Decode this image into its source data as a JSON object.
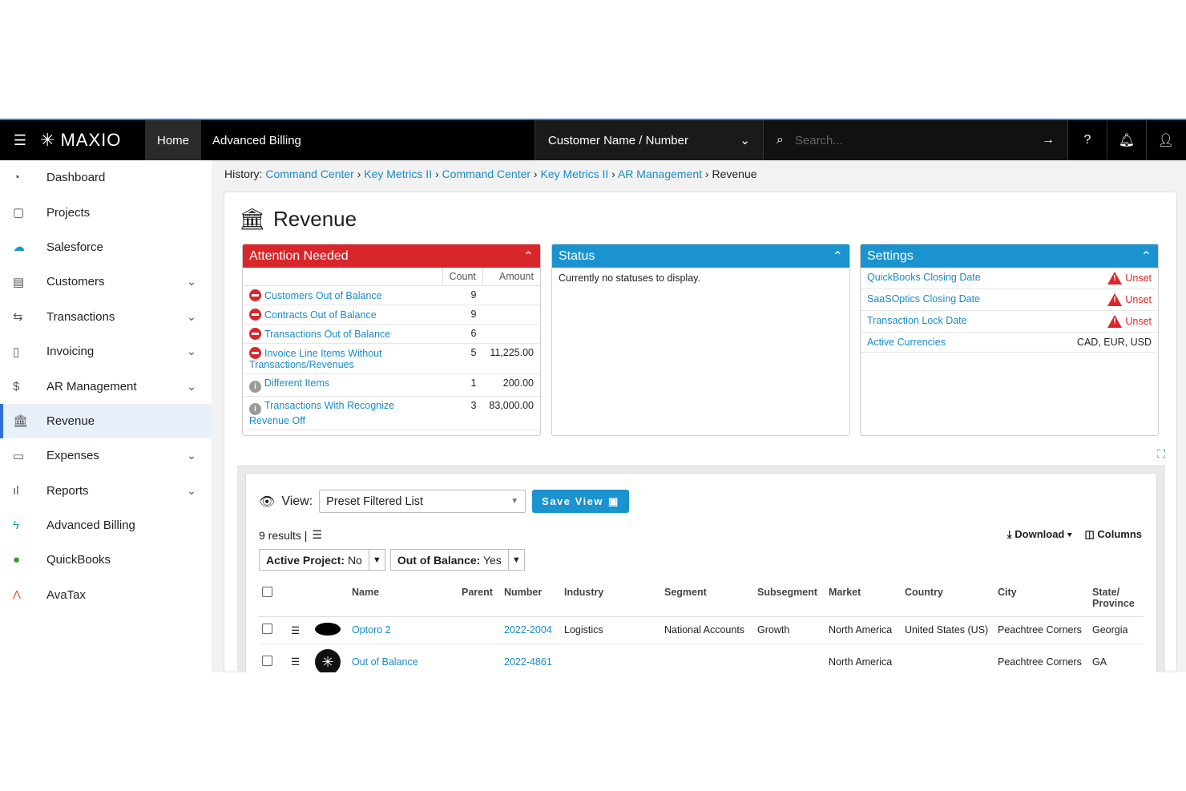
{
  "topbar": {
    "logo": "MAXIO",
    "home": "Home",
    "app": "Advanced Billing",
    "customer_select": "Customer Name / Number",
    "search_placeholder": "Search..."
  },
  "sidebar": {
    "items": [
      {
        "label": "Dashboard"
      },
      {
        "label": "Projects"
      },
      {
        "label": "Salesforce"
      },
      {
        "label": "Customers"
      },
      {
        "label": "Transactions"
      },
      {
        "label": "Invoicing"
      },
      {
        "label": "AR Management"
      },
      {
        "label": "Revenue"
      },
      {
        "label": "Expenses"
      },
      {
        "label": "Reports"
      },
      {
        "label": "Advanced Billing"
      },
      {
        "label": "QuickBooks"
      },
      {
        "label": "AvaTax"
      }
    ]
  },
  "history": {
    "label": "History:",
    "links": [
      "Command Center",
      "Key Metrics II",
      "Command Center",
      "Key Metrics II",
      "AR Management"
    ],
    "current": "Revenue"
  },
  "page": {
    "title": "Revenue"
  },
  "attention": {
    "title": "Attention Needed",
    "col_count": "Count",
    "col_amount": "Amount",
    "rows": [
      {
        "label": "Customers Out of Balance",
        "count": "9",
        "amount": ""
      },
      {
        "label": "Contracts Out of Balance",
        "count": "9",
        "amount": ""
      },
      {
        "label": "Transactions Out of Balance",
        "count": "6",
        "amount": ""
      },
      {
        "label": "Invoice Line Items Without Transactions/Revenues",
        "count": "5",
        "amount": "11,225.00"
      },
      {
        "label": "Different Items",
        "count": "1",
        "amount": "200.00"
      },
      {
        "label": "Transactions With Recognize Revenue Off",
        "count": "3",
        "amount": "83,000.00"
      }
    ]
  },
  "status": {
    "title": "Status",
    "message": "Currently no statuses to display."
  },
  "settings": {
    "title": "Settings",
    "rows": [
      {
        "label": "QuickBooks Closing Date",
        "value": "Unset"
      },
      {
        "label": "SaaSOptics Closing Date",
        "value": "Unset"
      },
      {
        "label": "Transaction Lock Date",
        "value": "Unset"
      },
      {
        "label": "Active Currencies",
        "value": "CAD, EUR, USD"
      }
    ]
  },
  "list": {
    "view_label": "View:",
    "view_value": "Preset Filtered List",
    "save_view": "Save View",
    "results": "9 results |",
    "download": "Download",
    "columns": "Columns",
    "filter1_label": "Active Project:",
    "filter1_value": "No",
    "filter2_label": "Out of Balance:",
    "filter2_value": "Yes",
    "headers": [
      "Name",
      "Parent",
      "Number",
      "Industry",
      "Segment",
      "Subsegment",
      "Market",
      "Country",
      "City",
      "State/ Province"
    ],
    "rows": [
      {
        "name": "Optoro 2",
        "parent": "",
        "number": "2022-2004",
        "industry": "Logistics",
        "segment": "National Accounts",
        "subsegment": "Growth",
        "market": "North America",
        "country": "United States (US)",
        "city": "Peachtree Corners",
        "state": "Georgia"
      },
      {
        "name": "Out of Balance",
        "parent": "",
        "number": "2022-4861",
        "industry": "",
        "segment": "",
        "subsegment": "",
        "market": "North America",
        "country": "",
        "city": "Peachtree Corners",
        "state": "GA"
      }
    ]
  }
}
